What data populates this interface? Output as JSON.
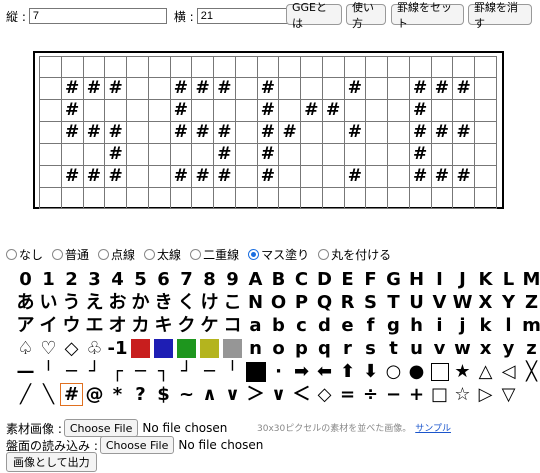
{
  "controls": {
    "rows_label": "縦 :",
    "rows_value": "7",
    "cols_label": "横 :",
    "cols_value": "21",
    "btn_gge": "GGEとは",
    "btn_howto": "使い方",
    "btn_set_lines": "罫線をセット",
    "btn_clear_lines": "罫線を消す"
  },
  "board": {
    "rows": [
      [
        "",
        "",
        "",
        "",
        "",
        "",
        "",
        "",
        "",
        "",
        "",
        "",
        "",
        "",
        "",
        "",
        "",
        "",
        "",
        "",
        ""
      ],
      [
        "",
        "#",
        "#",
        "#",
        "",
        "",
        "#",
        "#",
        "#",
        "",
        "#",
        "",
        "",
        "",
        "#",
        "",
        "",
        "#",
        "#",
        "#",
        ""
      ],
      [
        "",
        "#",
        "",
        "",
        "",
        "",
        "#",
        "",
        "",
        "",
        "#",
        "",
        "#",
        "#",
        "",
        "",
        "",
        "#",
        "",
        "",
        ""
      ],
      [
        "",
        "#",
        "#",
        "#",
        "",
        "",
        "#",
        "#",
        "#",
        "",
        "#",
        "#",
        "",
        "",
        "#",
        "",
        "",
        "#",
        "#",
        "#",
        ""
      ],
      [
        "",
        "",
        "",
        "#",
        "",
        "",
        "",
        "",
        "#",
        "",
        "#",
        "",
        "",
        "",
        "",
        "",
        "",
        "#",
        "",
        "",
        ""
      ],
      [
        "",
        "#",
        "#",
        "#",
        "",
        "",
        "#",
        "#",
        "#",
        "",
        "#",
        "",
        "",
        "",
        "#",
        "",
        "",
        "#",
        "#",
        "#",
        ""
      ],
      [
        "",
        "",
        "",
        "",
        "",
        "",
        "",
        "",
        "",
        "",
        "",
        "",
        "",
        "",
        "",
        "",
        "",
        "",
        "",
        "",
        ""
      ]
    ]
  },
  "modes": [
    {
      "label": "なし",
      "selected": false
    },
    {
      "label": "普通",
      "selected": false
    },
    {
      "label": "点線",
      "selected": false
    },
    {
      "label": "太線",
      "selected": false
    },
    {
      "label": "二重線",
      "selected": false
    },
    {
      "label": "マス塗り",
      "selected": true
    },
    {
      "label": "丸を付ける",
      "selected": false
    }
  ],
  "palette": {
    "row1": [
      "0",
      "1",
      "2",
      "3",
      "4",
      "5",
      "6",
      "7",
      "8",
      "9",
      "A",
      "B",
      "C",
      "D",
      "E",
      "F",
      "G",
      "H",
      "I",
      "J",
      "K",
      "L",
      "M"
    ],
    "row2": [
      "あ",
      "い",
      "う",
      "え",
      "お",
      "か",
      "き",
      "く",
      "け",
      "こ",
      "N",
      "O",
      "P",
      "Q",
      "R",
      "S",
      "T",
      "U",
      "V",
      "W",
      "X",
      "Y",
      "Z"
    ],
    "row3": [
      "ア",
      "イ",
      "ウ",
      "エ",
      "オ",
      "カ",
      "キ",
      "ク",
      "ケ",
      "コ",
      "a",
      "b",
      "c",
      "d",
      "e",
      "f",
      "g",
      "h",
      "i",
      "j",
      "k",
      "l",
      "m"
    ],
    "row4_text": [
      "♤",
      "♡",
      "◇",
      "♧",
      "-1"
    ],
    "row4_colors": [
      "#c81e1e",
      "#1e1eb4",
      "#1e961e",
      "#b4b41e",
      "#969696"
    ],
    "row4_letters": [
      "n",
      "o",
      "p",
      "q",
      "r",
      "s",
      "t",
      "u",
      "v",
      "w",
      "x",
      "y",
      "z"
    ],
    "row5": [
      "—",
      "╵",
      "─",
      "┘",
      "┌",
      "─",
      "┐",
      "┘",
      "─",
      "╵",
      "■",
      "·",
      "➡",
      "⬅",
      "⬆",
      "⬇",
      "○",
      "●",
      "□",
      "★",
      "△",
      "◁",
      "╳"
    ],
    "row6": [
      "╱",
      "╲",
      "#",
      "@",
      "*",
      "?",
      "$",
      "~",
      "∧",
      "∨",
      "＞",
      "∨",
      "＜",
      "◇",
      "=",
      "÷",
      "−",
      "+",
      "□",
      "☆",
      "▷",
      "▽"
    ]
  },
  "files": {
    "material_label": "素材画像 :",
    "choose_file": "Choose File",
    "no_file": "No file chosen",
    "note": "30x30ピクセルの素材を並べた画像。",
    "sample_link": "サンプル",
    "load_label": "盤面の読み込み :",
    "export_button": "画像として出力"
  }
}
